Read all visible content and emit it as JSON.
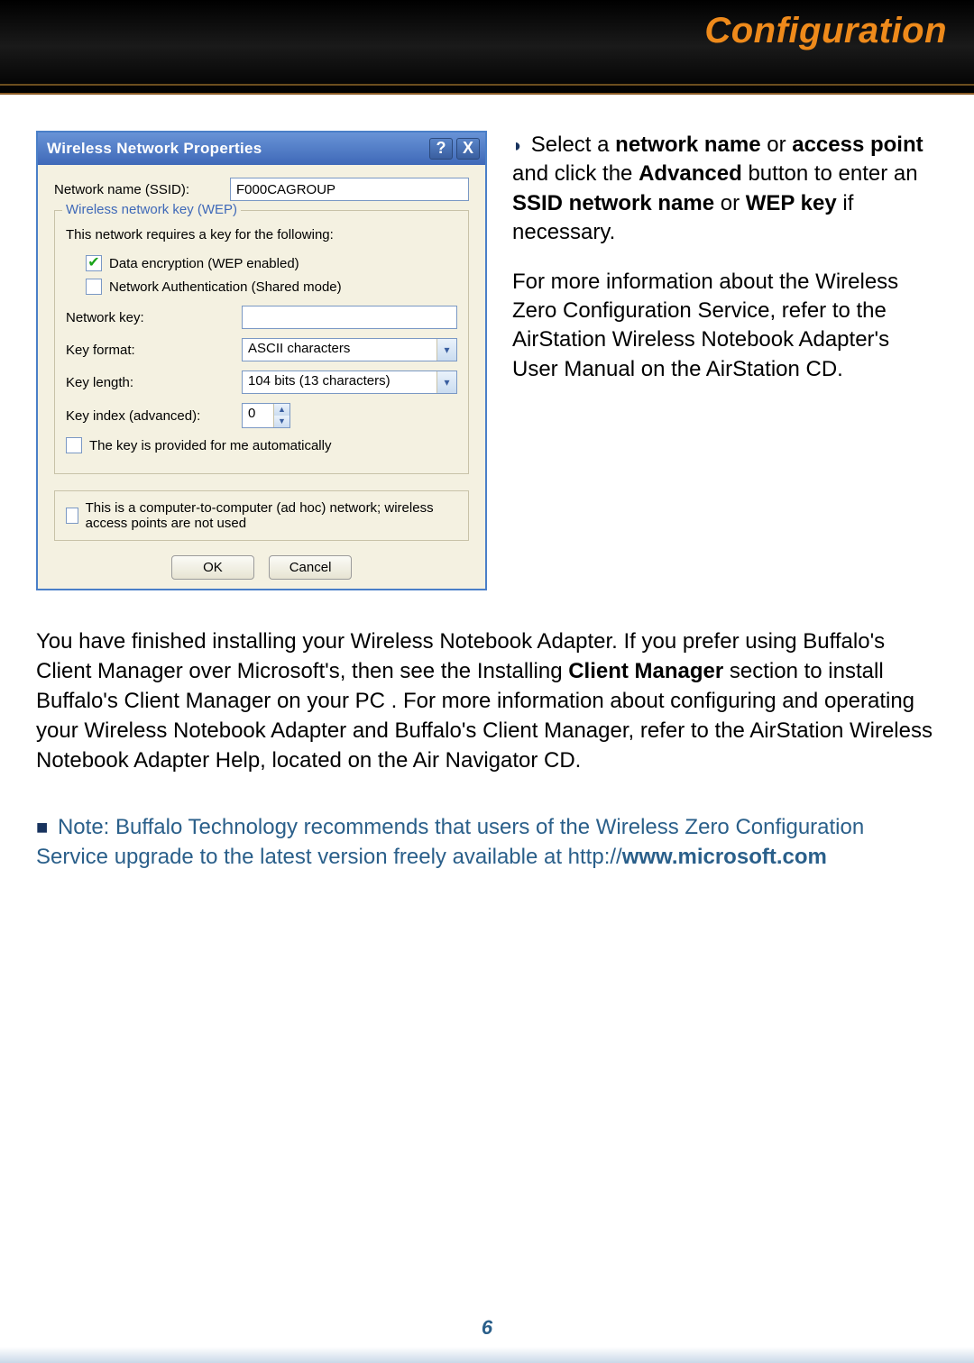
{
  "header": {
    "title": "Configuration"
  },
  "dialog": {
    "title": "Wireless Network Properties",
    "help_btn": "?",
    "close_btn": "X",
    "ssid_label": "Network name (SSID):",
    "ssid_value": "F000CAGROUP",
    "wep_group_legend": "Wireless network key (WEP)",
    "requires_text": "This network requires a key for the following:",
    "cb_data_encryption": "Data encryption (WEP enabled)",
    "cb_network_auth": "Network Authentication (Shared mode)",
    "network_key_label": "Network key:",
    "network_key_value": "",
    "key_format_label": "Key format:",
    "key_format_value": "ASCII characters",
    "key_length_label": "Key length:",
    "key_length_value": "104 bits (13 characters)",
    "key_index_label": "Key index (advanced):",
    "key_index_value": "0",
    "cb_auto_key": "The key is provided for me automatically",
    "cb_adhoc": "This is a computer-to-computer (ad hoc) network; wireless access points are not used",
    "ok": "OK",
    "cancel": "Cancel"
  },
  "side": {
    "p1_a": "Select a ",
    "p1_b": "network name",
    "p1_c": " or ",
    "p1_d": "access point",
    "p1_e": " and click the ",
    "p1_f": "Advanced",
    "p1_g": " button to enter an ",
    "p1_h": "SSID network name",
    "p1_i": " or ",
    "p1_j": "WEP key",
    "p1_k": " if necessary.",
    "p2": "For more information about the Wireless Zero Configuration Service, refer to the AirStation Wireless Notebook Adapter's User Manual on the AirStation CD."
  },
  "body": {
    "p1_a": "You have finished installing your Wireless Notebook Adapter.  If you prefer using Buffalo's Client Manager over Microsoft's, then see the Installing ",
    "p1_b": "Client Manager",
    "p1_c": " section to install Buffalo's Client Manager on your PC .  For more information about configuring and operating your Wireless Notebook Adapter and Buffalo's Client Manager, refer to the AirStation Wireless Notebook Adapter Help, located on the Air Navigator CD."
  },
  "note": {
    "a": "Note: Buffalo Technology recommends that users of the Wireless Zero Configuration Service upgrade to the latest version freely available at http://",
    "b": "www.microsoft.com"
  },
  "page_number": "6"
}
